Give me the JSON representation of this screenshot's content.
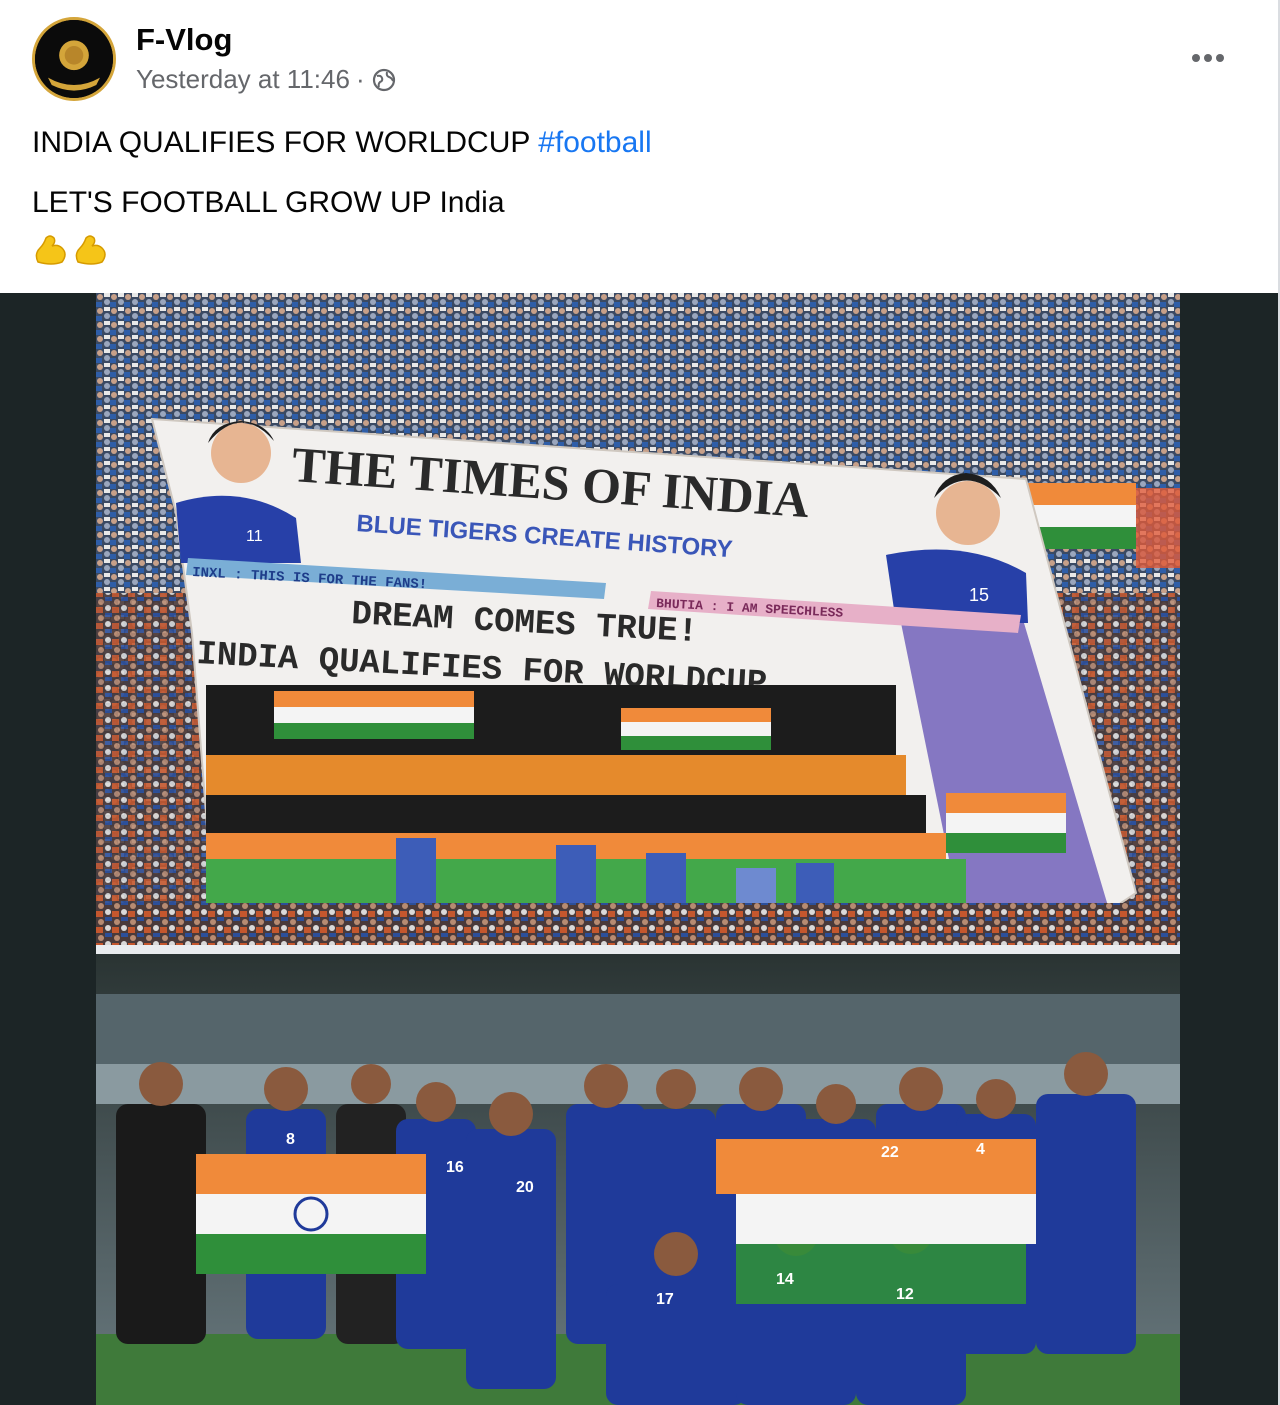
{
  "post": {
    "author": "F-Vlog",
    "timestamp": "Yesterday at 11:46",
    "separator": "·",
    "audience_icon": "globe-icon",
    "more_icon": "more-options-icon",
    "text_line1": "INDIA QUALIFIES FOR WORLDCUP",
    "hashtag": "#football",
    "text_line2": "LET'S FOOTBALL GROW UP India",
    "emojis": [
      "flexed-biceps-emoji",
      "flexed-biceps-emoji"
    ]
  },
  "media": {
    "banner": {
      "headline": "THE TIMES OF INDIA",
      "subhead": "BLUE TIGERS CREATE HISTORY",
      "strip_left": "INXL : THIS IS FOR THE FANS!",
      "strip_right": "BHUTIA : I AM SPEECHLESS",
      "main_line1": "DREAM COMES TRUE!",
      "main_line2": "INDIA QUALIFIES FOR WORLDCUP",
      "jersey_left": "11",
      "jersey_right": "15"
    },
    "team_jerseys": [
      "8",
      "16",
      "20",
      "22",
      "14",
      "17",
      "12",
      "4"
    ]
  },
  "colors": {
    "link": "#1877f2",
    "secondary_text": "#65676b",
    "media_bg": "#1c2526",
    "saffron": "#f08a3a",
    "india_green": "#2f8f3a",
    "jersey_blue": "#1f3a9a"
  }
}
